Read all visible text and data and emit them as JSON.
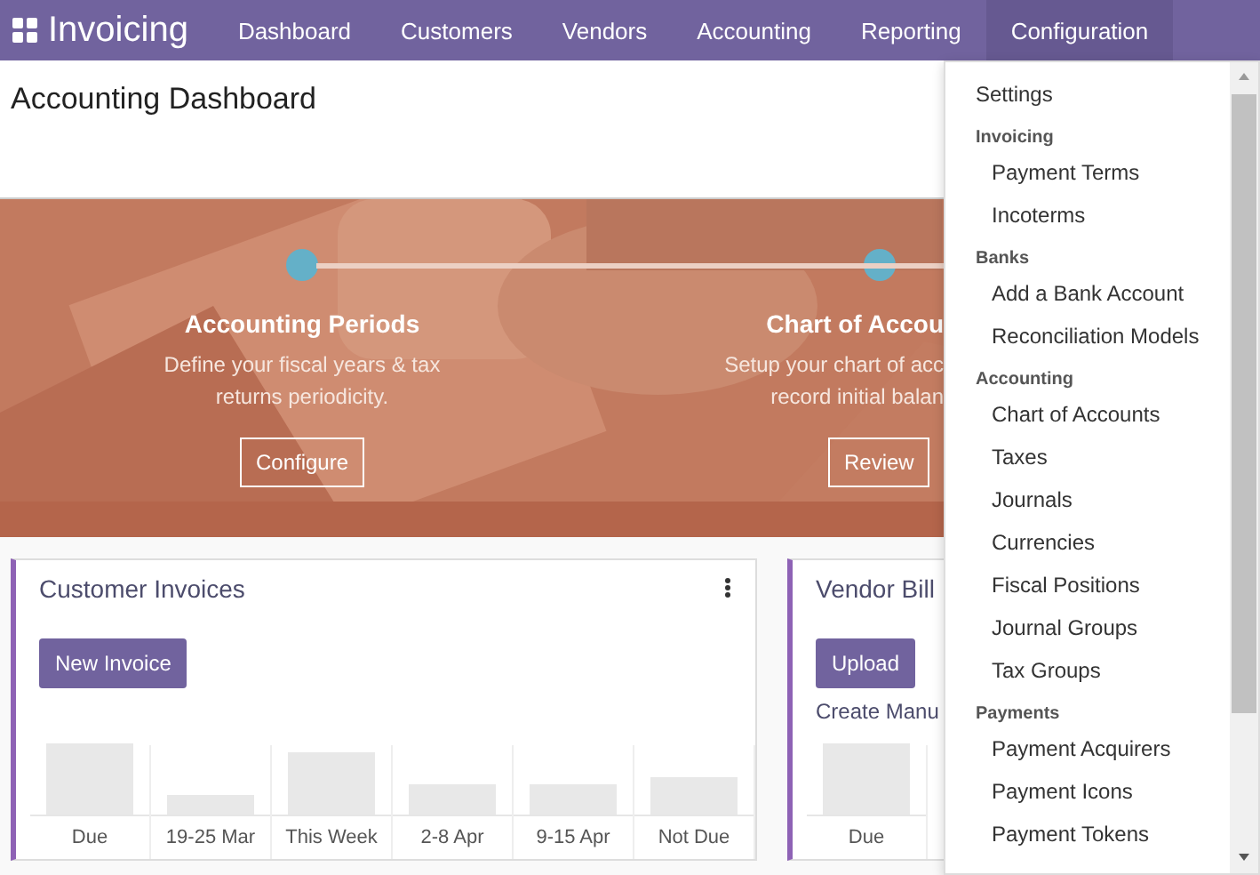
{
  "navbar": {
    "app_title": "Invoicing",
    "menu": [
      {
        "label": "Dashboard",
        "selected": false
      },
      {
        "label": "Customers",
        "selected": false
      },
      {
        "label": "Vendors",
        "selected": false
      },
      {
        "label": "Accounting",
        "selected": false
      },
      {
        "label": "Reporting",
        "selected": false
      },
      {
        "label": "Configuration",
        "selected": true
      }
    ]
  },
  "page_title": "Accounting Dashboard",
  "banner": {
    "steps": [
      {
        "title": "Accounting Periods",
        "description": [
          "Define your fiscal years & tax",
          "returns periodicity."
        ],
        "button": "Configure"
      },
      {
        "title": "Chart of Accou",
        "description": [
          "Setup your chart of acc",
          "record initial balan"
        ],
        "button": "Review"
      }
    ]
  },
  "cards": [
    {
      "title": "Customer Invoices",
      "button": "New Invoice",
      "has_menu": true,
      "labels": [
        "Due",
        "19-25 Mar",
        "This Week",
        "2-8 Apr",
        "9-15 Apr",
        "Not Due"
      ]
    },
    {
      "title": "Vendor Bill",
      "button": "Upload",
      "link": "Create Manu",
      "labels": [
        "Due"
      ]
    }
  ],
  "dropdown": {
    "sections": [
      {
        "items": [
          "Settings"
        ]
      },
      {
        "header": "Invoicing",
        "items": [
          "Payment Terms",
          "Incoterms"
        ]
      },
      {
        "header": "Banks",
        "items": [
          "Add a Bank Account",
          "Reconciliation Models"
        ]
      },
      {
        "header": "Accounting",
        "items": [
          "Chart of Accounts",
          "Taxes",
          "Journals",
          "Currencies",
          "Fiscal Positions",
          "Journal Groups",
          "Tax Groups"
        ]
      },
      {
        "header": "Payments",
        "items": [
          "Payment Acquirers",
          "Payment Icons",
          "Payment Tokens"
        ]
      }
    ]
  }
}
